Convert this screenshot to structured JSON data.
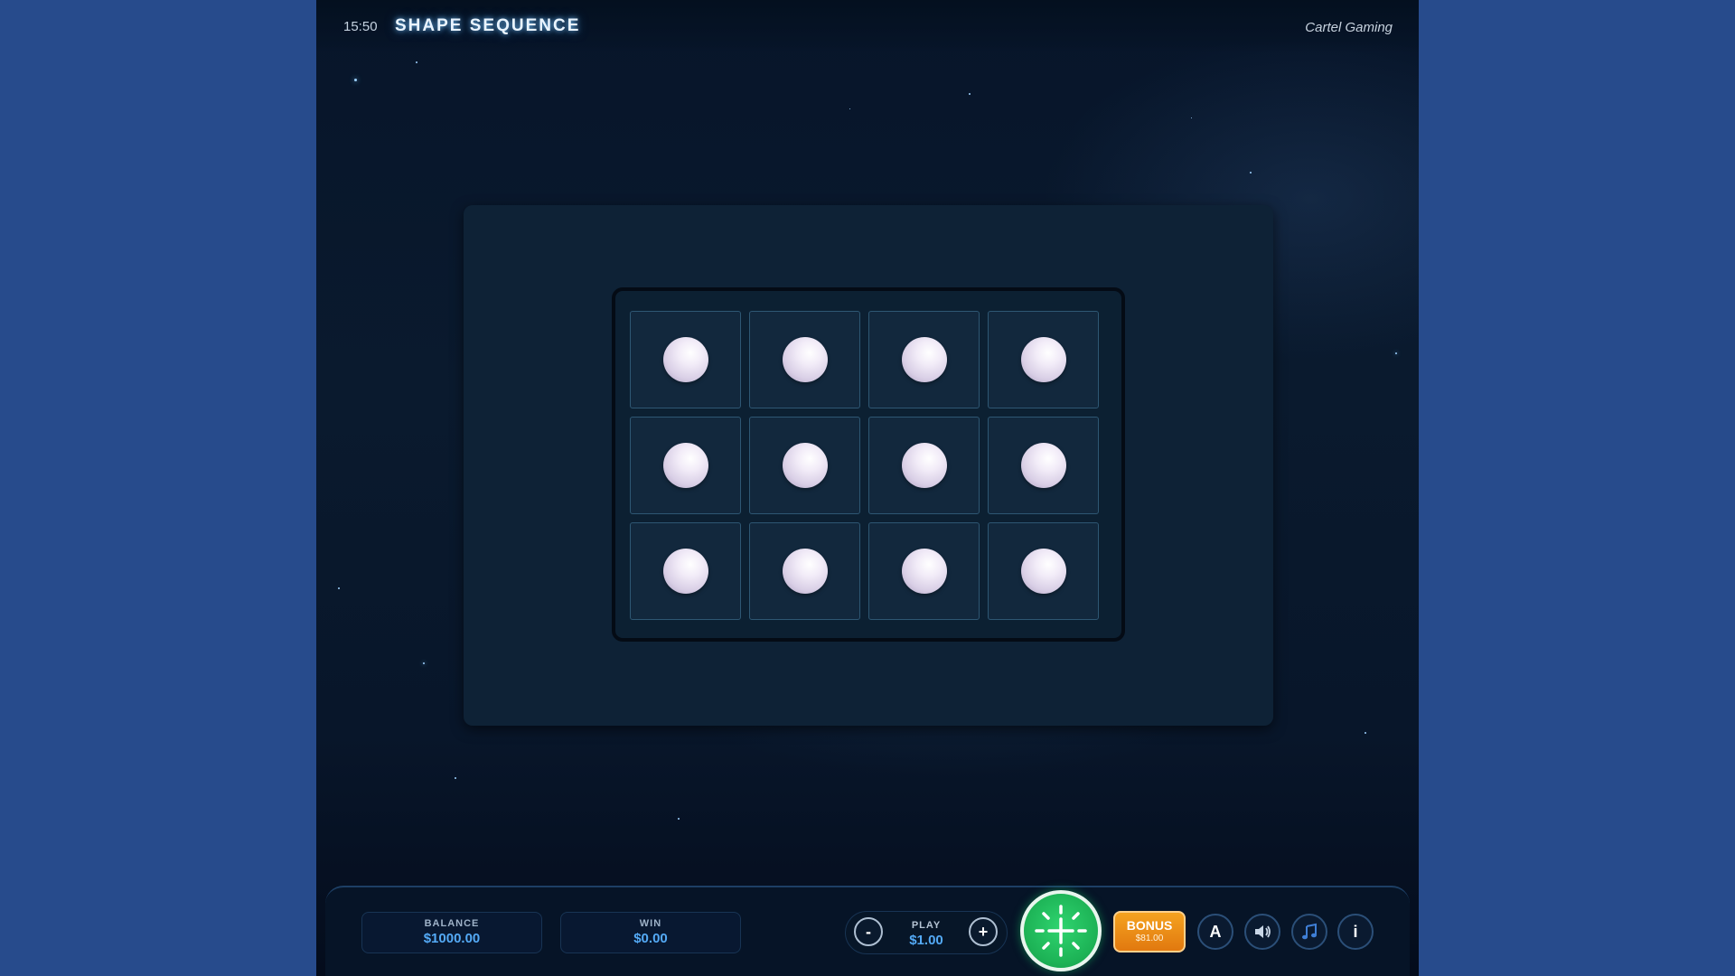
{
  "header": {
    "clock": "15:50",
    "title": "SHAPE SEQUENCE",
    "brand": "Cartel Gaming"
  },
  "grid": {
    "rows": 3,
    "columns": 4,
    "cell_symbol": "white-orb",
    "orb_color": "#f2ecf8"
  },
  "footer": {
    "balance_label": "BALANCE",
    "balance_value": "$1000.00",
    "win_label": "WIN",
    "win_value": "$0.00",
    "play_label": "PLAY",
    "play_value": "$1.00",
    "decrease_label": "-",
    "increase_label": "+",
    "bonus_label": "BONUS",
    "bonus_price": "$81.00",
    "autoplay_label": "A",
    "info_label": "i"
  },
  "colors": {
    "accent_blue": "#54aaf6",
    "spin_green": "#1db356",
    "bonus_orange": "#f5a320",
    "page_background": "#274b8c"
  },
  "icons": {
    "spin": "sparkle-plus-icon",
    "sound": "speaker-icon",
    "music": "music-note-icon"
  }
}
